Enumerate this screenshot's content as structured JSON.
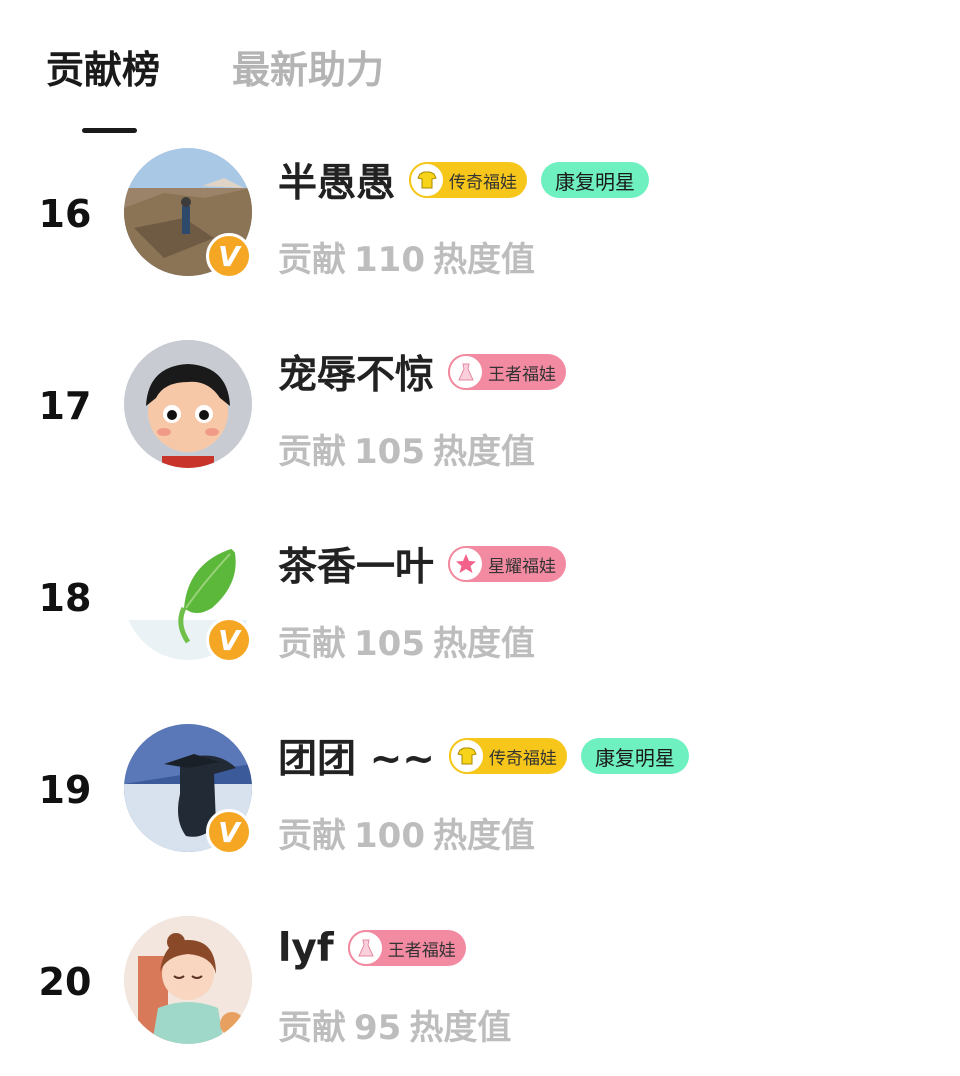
{
  "tabs": [
    {
      "label": "贡献榜",
      "active": true
    },
    {
      "label": "最新助力",
      "active": false
    }
  ],
  "unit_label": "热度值",
  "contrib_prefix": "贡献",
  "colors": {
    "badge_legend": "#f7c61a",
    "badge_king": "#f28aa2",
    "badge_star": "#f28aa2",
    "badge_rehab": "#6ff0c0",
    "verified": "#f5a623"
  },
  "rows": [
    {
      "rank": "16",
      "name": "半愚愚",
      "verified": true,
      "badge": {
        "label": "传奇福娃",
        "icon": "yellow-shirt-icon"
      },
      "extra_badge": "康复明星",
      "contribution": "110"
    },
    {
      "rank": "17",
      "name": "宠辱不惊",
      "verified": false,
      "badge": {
        "label": "王者福娃",
        "icon": "pink-dress-icon"
      },
      "extra_badge": "",
      "contribution": "105"
    },
    {
      "rank": "18",
      "name": "茶香一叶",
      "verified": true,
      "badge": {
        "label": "星耀福娃",
        "icon": "pink-star-icon"
      },
      "extra_badge": "",
      "contribution": "105"
    },
    {
      "rank": "19",
      "name": "团团 ~~",
      "verified": true,
      "badge": {
        "label": "传奇福娃",
        "icon": "yellow-shirt-icon"
      },
      "extra_badge": "康复明星",
      "contribution": "100"
    },
    {
      "rank": "20",
      "name": "lyf",
      "verified": false,
      "badge": {
        "label": "王者福娃",
        "icon": "pink-dress-icon"
      },
      "extra_badge": "",
      "contribution": "95"
    }
  ]
}
